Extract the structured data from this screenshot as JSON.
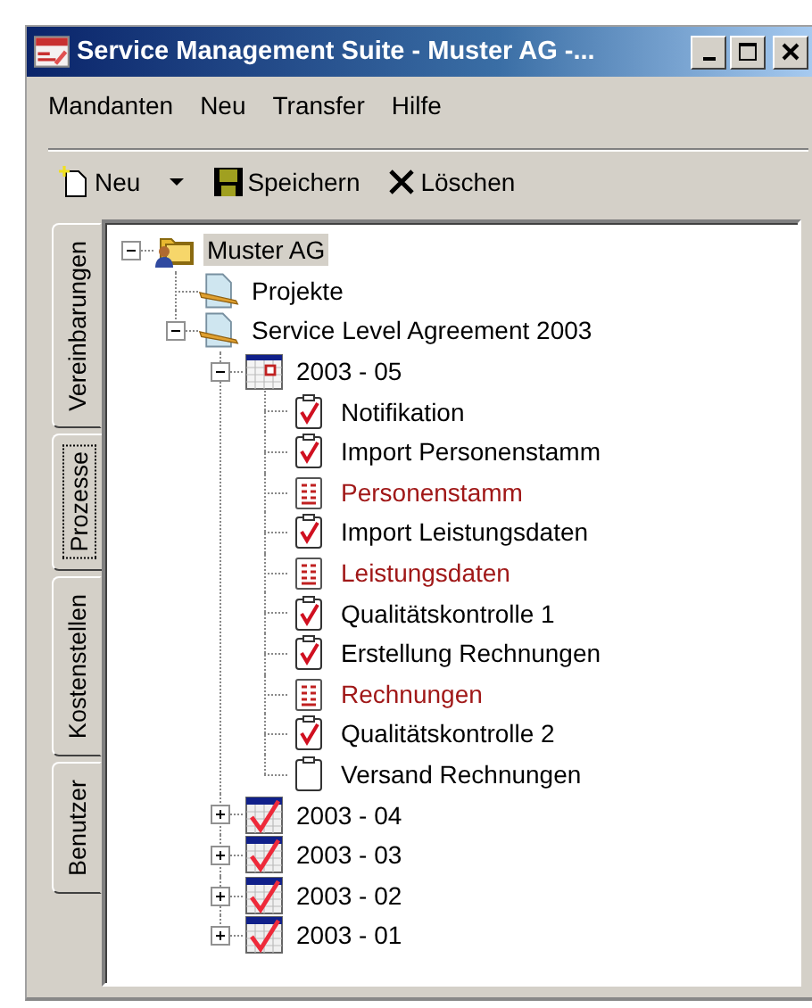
{
  "window": {
    "title": "Service Management Suite - Muster AG -..."
  },
  "menu": [
    "Mandanten",
    "Neu",
    "Transfer",
    "Hilfe"
  ],
  "toolbar": [
    {
      "kind": "new",
      "label": "Neu"
    },
    {
      "kind": "dropdown"
    },
    {
      "kind": "save",
      "label": "Speichern"
    },
    {
      "kind": "delete",
      "label": "Löschen"
    }
  ],
  "side_tabs": [
    {
      "label": "Vereinbarungen",
      "selected": false
    },
    {
      "label": "Prozesse",
      "selected": true
    },
    {
      "label": "Kostenstellen",
      "selected": false
    },
    {
      "label": "Benutzer",
      "selected": false
    }
  ],
  "tree": [
    {
      "label": "Muster AG",
      "kind": "company",
      "selected": true,
      "expanded": true,
      "children": [
        {
          "label": "Projekte",
          "kind": "document",
          "selected": false
        },
        {
          "label": "Service Level Agreement 2003",
          "kind": "document",
          "selected": false,
          "expanded": true,
          "children": [
            {
              "label": "2003 - 05",
              "kind": "period",
              "checked": false,
              "selected": false,
              "expanded": true,
              "children": [
                {
                  "label": "Notifikation",
                  "kind": "task",
                  "checked": true,
                  "selected": false
                },
                {
                  "label": "Import Personenstamm",
                  "kind": "task",
                  "checked": true,
                  "selected": false
                },
                {
                  "label": "Personenstamm",
                  "kind": "report",
                  "selected": false
                },
                {
                  "label": "Import Leistungsdaten",
                  "kind": "task",
                  "checked": true,
                  "selected": false
                },
                {
                  "label": "Leistungsdaten",
                  "kind": "report",
                  "selected": false
                },
                {
                  "label": "Qualitätskontrolle 1",
                  "kind": "task",
                  "checked": true,
                  "selected": false
                },
                {
                  "label": "Erstellung Rechnungen",
                  "kind": "task",
                  "checked": true,
                  "selected": false
                },
                {
                  "label": "Rechnungen",
                  "kind": "report",
                  "selected": false
                },
                {
                  "label": "Qualitätskontrolle 2",
                  "kind": "task",
                  "checked": true,
                  "selected": false
                },
                {
                  "label": "Versand Rechnungen",
                  "kind": "task",
                  "checked": false,
                  "selected": false
                }
              ]
            },
            {
              "label": "2003 - 04",
              "kind": "period",
              "checked": true,
              "selected": false,
              "expanded": false
            },
            {
              "label": "2003 - 03",
              "kind": "period",
              "checked": true,
              "selected": false,
              "expanded": false
            },
            {
              "label": "2003 - 02",
              "kind": "period",
              "checked": true,
              "selected": false,
              "expanded": false
            },
            {
              "label": "2003 - 01",
              "kind": "period",
              "checked": true,
              "selected": false,
              "expanded": false
            }
          ]
        }
      ]
    }
  ]
}
